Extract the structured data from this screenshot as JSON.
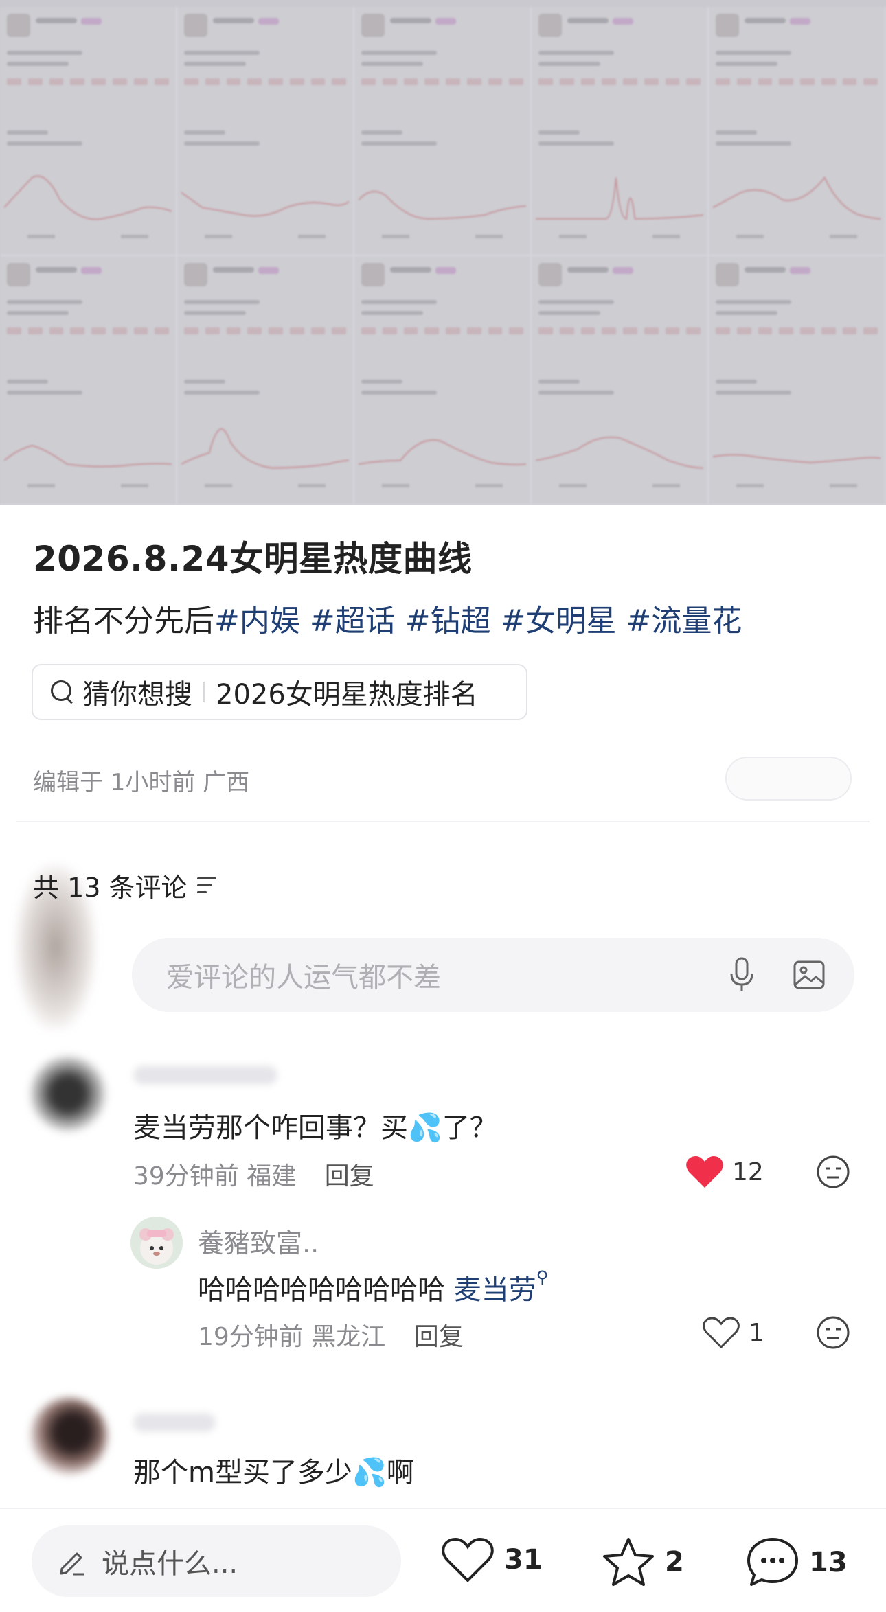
{
  "post": {
    "title": "2026.8.24女明星热度曲线",
    "desc_plain": "排名不分先后",
    "hashtags": [
      "#内娱",
      "#超话",
      "#钻超",
      "#女明星",
      "#流量花"
    ],
    "guess_label": "猜你想搜",
    "guess_query": "2026女明星热度排名",
    "edited": "编辑于 1小时前 广西"
  },
  "comments_header": {
    "count_label": "共 13 条评论",
    "input_placeholder": "爱评论的人运气都不差"
  },
  "comments": [
    {
      "text_before": "麦当劳那个咋回事？买",
      "emoji": "💦",
      "text_after": "了？",
      "time": "39分钟前",
      "location": "福建",
      "reply_label": "回复",
      "likes": "12",
      "liked": true,
      "replies": [
        {
          "user": "養豬致富..",
          "text": "哈哈哈哈哈哈哈哈哈 ",
          "mention": "麦当劳",
          "time": "19分钟前",
          "location": "黑龙江",
          "reply_label": "回复",
          "likes": "1",
          "liked": false
        }
      ]
    },
    {
      "text_before": "那个m型买了多少",
      "emoji": "💦",
      "text_after": "啊"
    }
  ],
  "bottom_bar": {
    "say_placeholder": "说点什么...",
    "likes": "31",
    "favorites": "2",
    "comments": "13"
  },
  "colors": {
    "hashtag": "#1f3f74",
    "like_red": "#f0304a",
    "meta_gray": "#8a8a8f"
  }
}
